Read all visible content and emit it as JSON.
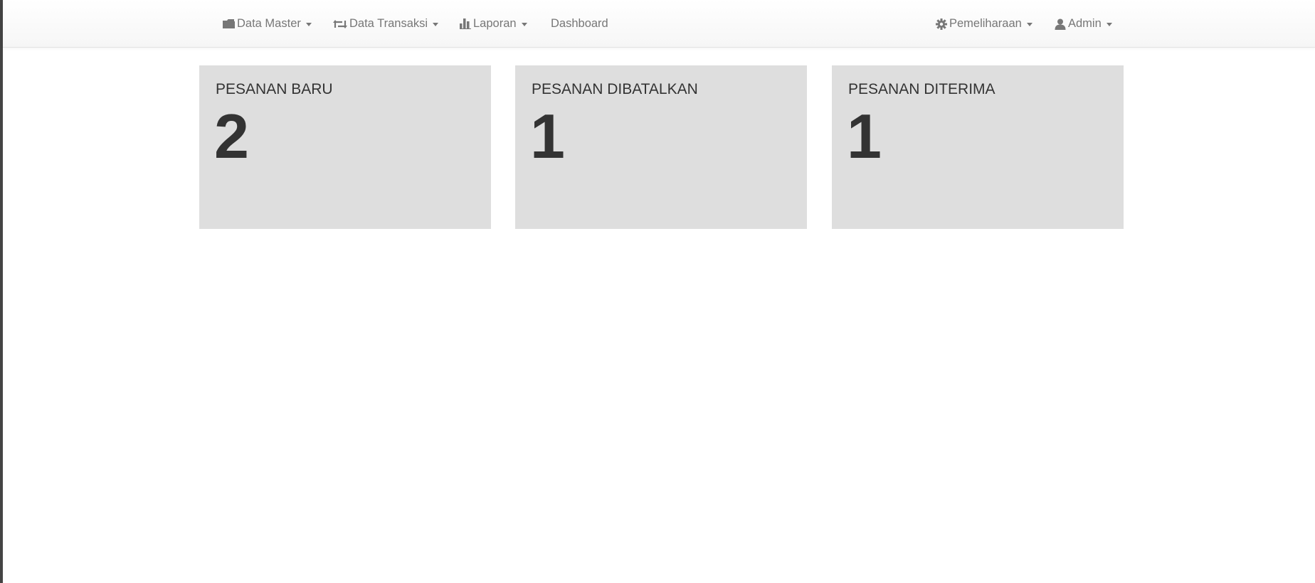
{
  "navbar": {
    "left_items": [
      {
        "label": "Data Master",
        "icon": "folder-icon",
        "has_caret": true
      },
      {
        "label": "Data Transaksi",
        "icon": "retweet-icon",
        "has_caret": true
      },
      {
        "label": "Laporan",
        "icon": "bar-chart-icon",
        "has_caret": true
      },
      {
        "label": "Dashboard",
        "icon": null,
        "has_caret": false
      }
    ],
    "right_items": [
      {
        "label": "Pemeliharaan",
        "icon": "gear-icon",
        "has_caret": true
      },
      {
        "label": "Admin",
        "icon": "user-icon",
        "has_caret": true
      }
    ]
  },
  "panels": [
    {
      "title": "PESANAN BARU",
      "count": "2"
    },
    {
      "title": "PESANAN DIBATALKAN",
      "count": "1"
    },
    {
      "title": "PESANAN DITERIMA",
      "count": "1"
    }
  ],
  "colors": {
    "nav_text": "#777777",
    "panel_bg": "#dedede",
    "panel_text": "#333333"
  }
}
